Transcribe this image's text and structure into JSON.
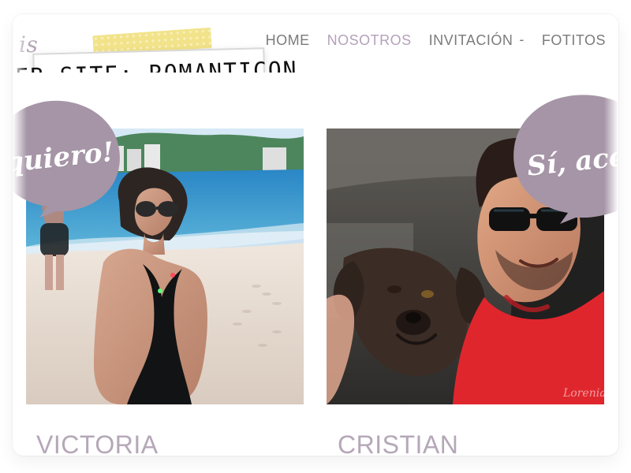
{
  "header": {
    "brand_fragment": "is",
    "nav": [
      {
        "label": "HOME",
        "active": false
      },
      {
        "label": "NOSOTROS",
        "active": true
      },
      {
        "label": "INVITACIÓN",
        "active": false,
        "has_dropdown": true,
        "caret": "-"
      },
      {
        "label": "FOTITOS",
        "active": false
      }
    ]
  },
  "badge": {
    "text": "WEB SITE: ROMANTICON"
  },
  "bubbles": {
    "left": {
      "text": "quiero!"
    },
    "right": {
      "text": "Sí, acep"
    }
  },
  "people": {
    "left": {
      "name": "VICTORIA"
    },
    "right": {
      "name": "CRISTIAN"
    }
  },
  "colors": {
    "accent_lilac": "#b4a1bb",
    "bubble_lilac": "#a695a7",
    "nav_gray": "#7b7b7b",
    "tape_yellow": "#f2e38a",
    "shirt_red": "#e0262d",
    "sea_blue": "#2e8bc8",
    "sand": "#e7ddd3"
  },
  "icons": {
    "dropdown": "chevron-down-icon",
    "bubble": "speech-bubble-icon"
  }
}
